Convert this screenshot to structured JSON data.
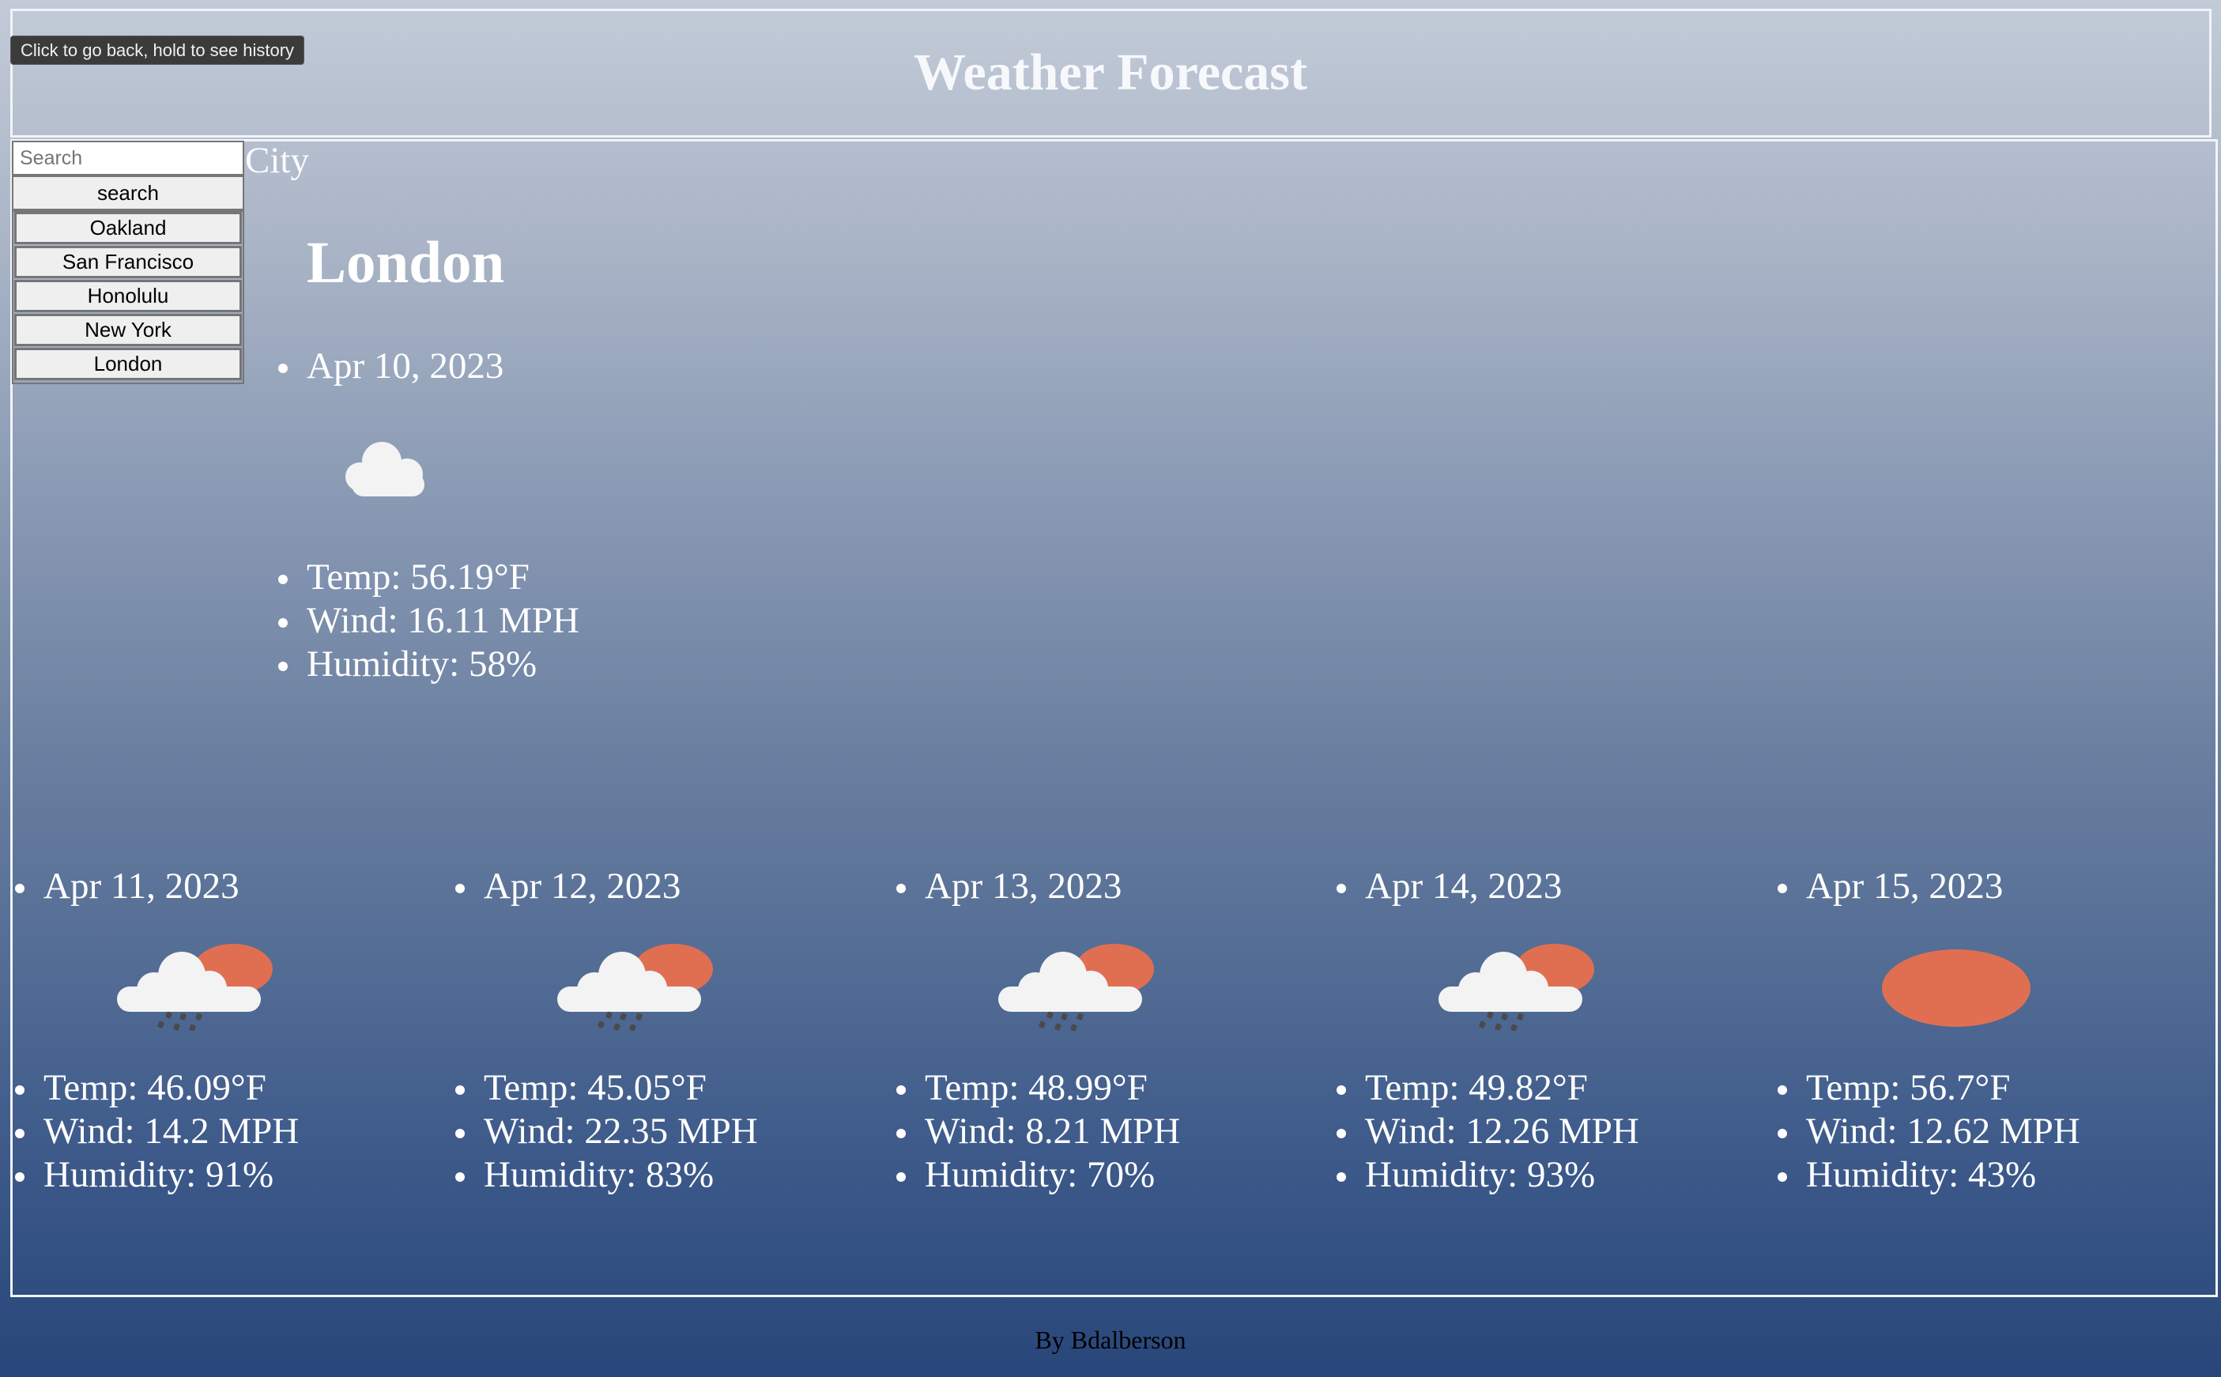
{
  "app": {
    "title": "Weather Forecast",
    "tooltip": "Click to go back, hold to see history",
    "footer": "By Bdalberson"
  },
  "search": {
    "placeholder": "Search",
    "button_label": "search",
    "history": [
      "Oakland",
      "San Francisco",
      "Honolulu",
      "New York",
      "London"
    ]
  },
  "current": {
    "section_label": "City",
    "city": "London",
    "date": "Apr 10, 2023",
    "icon": "cloud-icon",
    "temp": "Temp: 56.19°F",
    "wind": "Wind: 16.11 MPH",
    "humidity": "Humidity: 58%"
  },
  "forecast": [
    {
      "date": "Apr 11, 2023",
      "icon": "rain-sun-cloud-icon",
      "temp": "Temp: 46.09°F",
      "wind": "Wind: 14.2 MPH",
      "humidity": "Humidity: 91%"
    },
    {
      "date": "Apr 12, 2023",
      "icon": "rain-sun-cloud-icon",
      "temp": "Temp: 45.05°F",
      "wind": "Wind: 22.35 MPH",
      "humidity": "Humidity: 83%"
    },
    {
      "date": "Apr 13, 2023",
      "icon": "rain-sun-cloud-icon",
      "temp": "Temp: 48.99°F",
      "wind": "Wind: 8.21 MPH",
      "humidity": "Humidity: 70%"
    },
    {
      "date": "Apr 14, 2023",
      "icon": "rain-sun-cloud-icon",
      "temp": "Temp: 49.82°F",
      "wind": "Wind: 12.26 MPH",
      "humidity": "Humidity: 93%"
    },
    {
      "date": "Apr 15, 2023",
      "icon": "sun-icon",
      "temp": "Temp: 56.7°F",
      "wind": "Wind: 12.62 MPH",
      "humidity": "Humidity: 43%"
    }
  ],
  "colors": {
    "sun": "#e06f52",
    "cloud": "#f3f3f3",
    "rain": "#4a4a4a"
  }
}
